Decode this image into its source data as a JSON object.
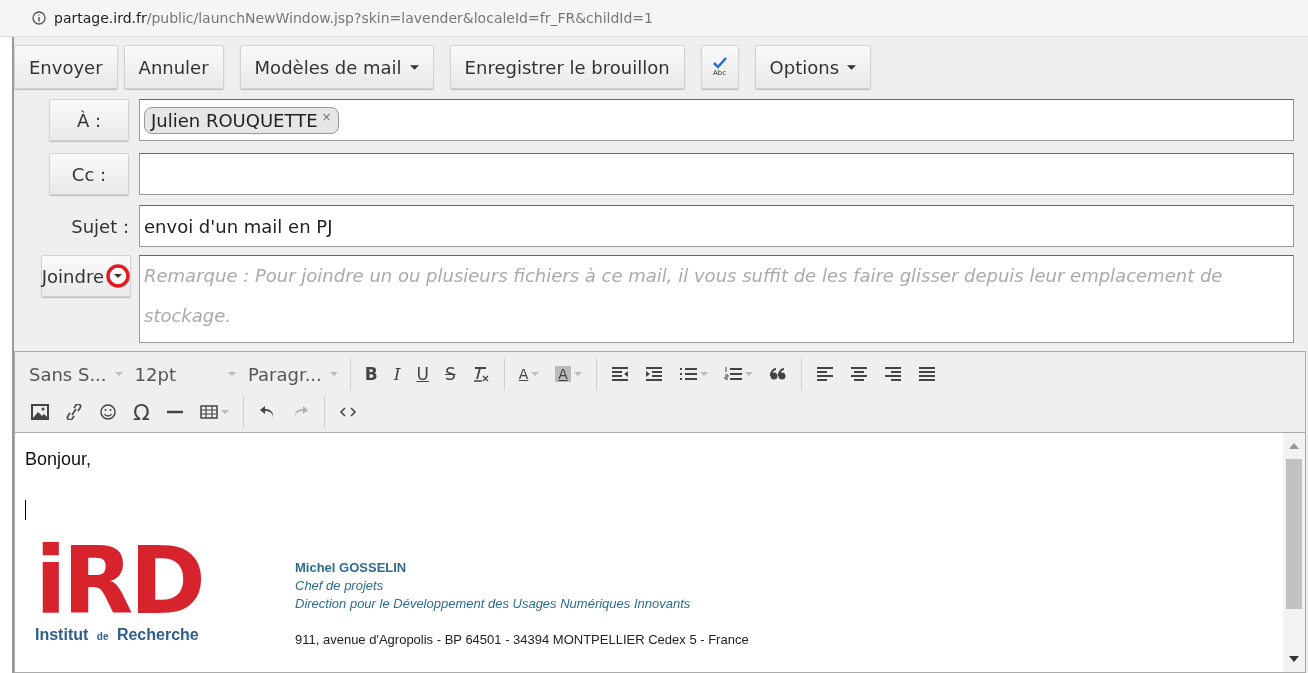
{
  "address_bar": {
    "host": "partage.ird.fr",
    "path": "/public/launchNewWindow.jsp?skin=lavender&localeId=fr_FR&childId=1"
  },
  "toolbar": [
    {
      "kind": "text",
      "label": "Envoyer",
      "dropdown": false
    },
    {
      "kind": "text",
      "label": "Annuler",
      "dropdown": false
    },
    {
      "kind": "text",
      "label": "Modèles de mail",
      "dropdown": true
    },
    {
      "kind": "text",
      "label": "Enregistrer le brouillon",
      "dropdown": false
    },
    {
      "kind": "spell",
      "label": "Abc",
      "dropdown": false
    },
    {
      "kind": "text",
      "label": "Options",
      "dropdown": true
    }
  ],
  "to": {
    "label": "À :",
    "chips": [
      {
        "name": "Julien ROUQUETTE",
        "remove": "×"
      }
    ]
  },
  "cc": {
    "label": "Cc :"
  },
  "subject": {
    "label": "Sujet :",
    "value": "envoi d'un mail en PJ"
  },
  "attach": {
    "label": "Joindre",
    "highlighted": true,
    "placeholder": "Remarque : Pour joindre un ou plusieurs fichiers à ce mail, il vous suffit de les faire glisser depuis leur emplacement de stockage."
  },
  "editor_toolbar": [
    [
      {
        "kind": "select",
        "label": "Sans S...",
        "dropdown": true
      },
      {
        "kind": "select",
        "label": "12pt",
        "dropdown": true
      },
      {
        "kind": "select",
        "label": "Paragr...",
        "dropdown": true
      },
      {
        "kind": "sep"
      },
      {
        "kind": "glyph",
        "label": "B",
        "dropdown": false,
        "disabled": false
      },
      {
        "kind": "glyph",
        "label": "I",
        "dropdown": false,
        "disabled": false
      },
      {
        "kind": "glyph",
        "label": "U",
        "dropdown": false,
        "disabled": false
      },
      {
        "kind": "glyph",
        "label": "S",
        "dropdown": false,
        "disabled": false
      },
      {
        "kind": "icon",
        "dropdown": false,
        "disabled": false
      },
      {
        "kind": "sep"
      },
      {
        "kind": "glyph",
        "label": "A",
        "dropdown": true,
        "disabled": false
      },
      {
        "kind": "glyph",
        "label": "A",
        "dropdown": true,
        "disabled": false
      },
      {
        "kind": "sep"
      },
      {
        "kind": "icon",
        "dropdown": false,
        "disabled": false
      },
      {
        "kind": "icon",
        "dropdown": false,
        "disabled": false
      },
      {
        "kind": "icon",
        "dropdown": true,
        "disabled": false
      },
      {
        "kind": "icon",
        "dropdown": true,
        "disabled": false
      },
      {
        "kind": "icon",
        "dropdown": false,
        "disabled": false
      },
      {
        "kind": "sep"
      },
      {
        "kind": "icon",
        "dropdown": false,
        "disabled": false
      },
      {
        "kind": "icon",
        "dropdown": false,
        "disabled": false
      },
      {
        "kind": "icon",
        "dropdown": false,
        "disabled": false
      },
      {
        "kind": "icon",
        "dropdown": false,
        "disabled": false
      }
    ],
    [
      {
        "kind": "icon",
        "dropdown": false,
        "disabled": false
      },
      {
        "kind": "icon",
        "dropdown": false,
        "disabled": false
      },
      {
        "kind": "icon",
        "dropdown": false,
        "disabled": false
      },
      {
        "kind": "glyph",
        "label": "Ω",
        "dropdown": false,
        "disabled": false
      },
      {
        "kind": "icon",
        "dropdown": false,
        "disabled": false
      },
      {
        "kind": "icon",
        "dropdown": true,
        "disabled": false
      },
      {
        "kind": "sep"
      },
      {
        "kind": "icon",
        "dropdown": false,
        "disabled": false
      },
      {
        "kind": "icon",
        "dropdown": false,
        "disabled": true
      },
      {
        "kind": "sep"
      },
      {
        "kind": "icon",
        "dropdown": false,
        "disabled": false
      }
    ]
  ],
  "body": {
    "greeting": "Bonjour,",
    "signature": {
      "logo": {
        "mark": "iRD",
        "caption_start": "Institut",
        "caption_middle": "de",
        "caption_end": "Recherche"
      },
      "name": "Michel GOSSELIN",
      "role": "Chef de projets",
      "department": "Direction pour le Développement des Usages Numériques Innovants",
      "address": "911, avenue d'Agropolis - BP 64501 - 34394 MONTPELLIER Cedex 5 - France"
    }
  }
}
